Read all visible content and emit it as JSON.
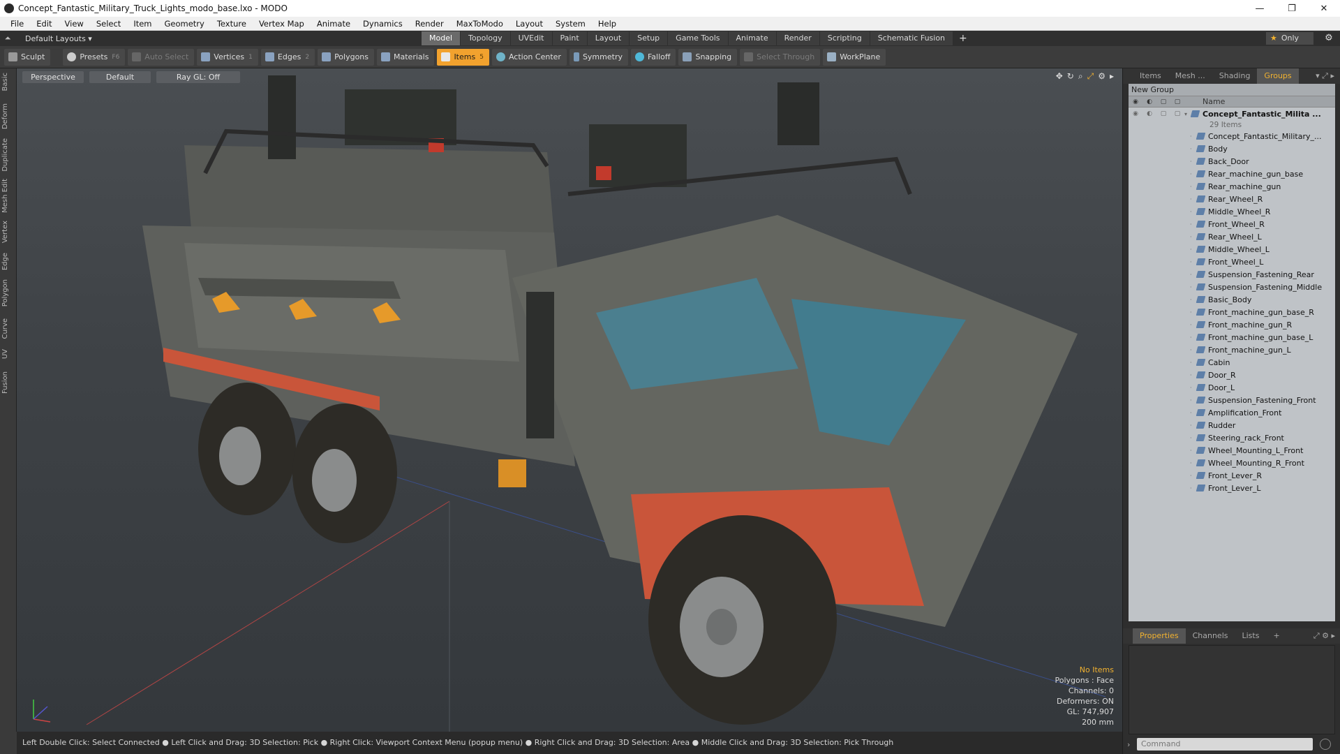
{
  "window": {
    "title": "Concept_Fantastic_Military_Truck_Lights_modo_base.lxo - MODO",
    "minimize": "—",
    "maximize": "❐",
    "close": "✕"
  },
  "menu": [
    "File",
    "Edit",
    "View",
    "Select",
    "Item",
    "Geometry",
    "Texture",
    "Vertex Map",
    "Animate",
    "Dynamics",
    "Render",
    "MaxToModo",
    "Layout",
    "System",
    "Help"
  ],
  "layoutbar": {
    "layout_selector": "Default Layouts ▾",
    "tabs": [
      "Model",
      "Topology",
      "UVEdit",
      "Paint",
      "Layout",
      "Setup",
      "Game Tools",
      "Animate",
      "Render",
      "Scripting",
      "Schematic Fusion"
    ],
    "active_tab": "Model",
    "plus": "+",
    "only_label": "Only",
    "star": "★",
    "gear": "⚙"
  },
  "toolbar": {
    "sculpt": "Sculpt",
    "presets": "Presets",
    "presets_key": "F6",
    "auto_select": "Auto Select",
    "vertices": "Vertices",
    "vertices_key": "1",
    "edges": "Edges",
    "edges_key": "2",
    "polygons": "Polygons",
    "materials": "Materials",
    "items": "Items",
    "items_key": "5",
    "action_center": "Action Center",
    "symmetry": "Symmetry",
    "falloff": "Falloff",
    "snapping": "Snapping",
    "select_through": "Select Through",
    "workplane": "WorkPlane"
  },
  "lefttabs": [
    "Basic",
    "Deform",
    "Duplicate",
    "Mesh Edit",
    "Vertex",
    "Edge",
    "Polygon",
    "Curve",
    "UV",
    "Fusion"
  ],
  "viewport": {
    "view": "Perspective",
    "shading": "Default",
    "ray": "Ray GL: Off",
    "info": {
      "selection": "No Items",
      "polygons": "Polygons : Face",
      "channels": "Channels: 0",
      "deformers": "Deformers: ON",
      "gl": "GL: 747,907",
      "scale": "200 mm"
    }
  },
  "statusbar": "Left Double Click: Select Connected ● Left Click and Drag: 3D Selection: Pick ● Right Click: Viewport Context Menu (popup menu) ● Right Click and Drag: 3D Selection: Area ● Middle Click and Drag: 3D Selection: Pick Through",
  "rightpanel": {
    "tabs": [
      "Items",
      "Mesh ...",
      "Shading",
      "Groups"
    ],
    "active_tab": "Groups",
    "new_group": "New Group",
    "name_header": "Name",
    "root": "Concept_Fantastic_Milita ...",
    "root_count": "29 Items",
    "items": [
      "Concept_Fantastic_Military_...",
      "Body",
      "Back_Door",
      "Rear_machine_gun_base",
      "Rear_machine_gun",
      "Rear_Wheel_R",
      "Middle_Wheel_R",
      "Front_Wheel_R",
      "Rear_Wheel_L",
      "Middle_Wheel_L",
      "Front_Wheel_L",
      "Suspension_Fastening_Rear",
      "Suspension_Fastening_Middle",
      "Basic_Body",
      "Front_machine_gun_base_R",
      "Front_machine_gun_R",
      "Front_machine_gun_base_L",
      "Front_machine_gun_L",
      "Cabin",
      "Door_R",
      "Door_L",
      "Suspension_Fastening_Front",
      "Amplification_Front",
      "Rudder",
      "Steering_rack_Front",
      "Wheel_Mounting_L_Front",
      "Wheel_Mounting_R_Front",
      "Front_Lever_R",
      "Front_Lever_L"
    ],
    "lower_tabs": [
      "Properties",
      "Channels",
      "Lists"
    ],
    "lower_active": "Properties",
    "command_placeholder": "Command"
  }
}
